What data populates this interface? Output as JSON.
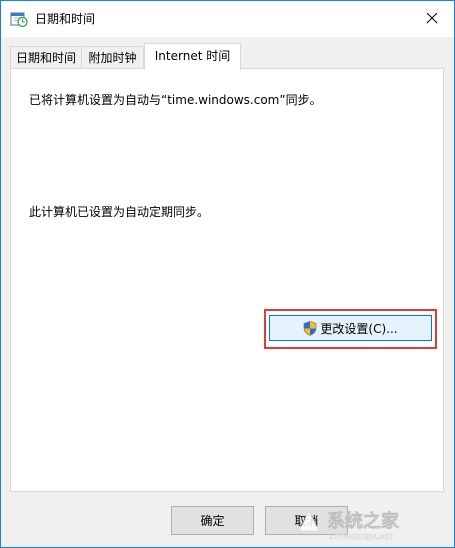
{
  "window": {
    "title": "日期和时间",
    "close_icon": "close-icon",
    "app_icon": "clock-calendar-icon",
    "accent": "#1883d7"
  },
  "tabs": [
    {
      "label": "日期和时间",
      "active": false
    },
    {
      "label": "附加时钟",
      "active": false
    },
    {
      "label": "Internet 时间",
      "active": true
    }
  ],
  "panel": {
    "sync_status": "已将计算机设置为自动与“time.windows.com”同步。",
    "schedule_status": "此计算机已设置为自动定期同步。",
    "change_settings_label": "更改设置(C)...",
    "change_settings_icon": "uac-shield-icon",
    "highlight_color": "#e03a3a"
  },
  "footer": {
    "ok_label": "确定",
    "cancel_label": "取消"
  },
  "watermark": {
    "text": "系统之家",
    "subtext": "XITONGZHIJIA.NET"
  }
}
